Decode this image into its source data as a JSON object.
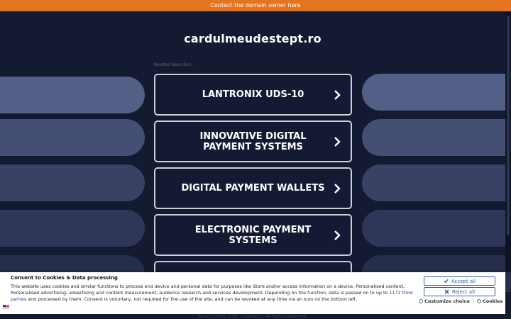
{
  "topbar": {
    "text": "Contact the domain owner here"
  },
  "page": {
    "domain": "cardulmeudestept.ro",
    "related_label": "Related Searches:"
  },
  "cards": [
    {
      "label": "LANTRONIX UDS-10"
    },
    {
      "label": "INNOVATIVE DIGITAL PAYMENT SYSTEMS"
    },
    {
      "label": "DIGITAL PAYMENT WALLETS"
    },
    {
      "label": "ELECTRONIC PAYMENT SYSTEMS"
    },
    {
      "label": ""
    }
  ],
  "footer": {
    "text": "Privacy Policy  2025 Copyright | All Rights Reserved."
  },
  "consent": {
    "title": "Consent to Cookies & Data processing",
    "text_before": "This website uses cookies and similar functions to process end device and personal data for purposes like Store and/or access information on a device, Personalised content, Personalised advertising, advertising and content measurement, audience research and services development. Depending on the function, data is passed on to up to ",
    "link": "1172 third parties",
    "text_after": " and processed by them. Consent is voluntary, not required for the use of the site, and can be revoked at any time via an icon on the bottom left.",
    "accept_label": "Accept all",
    "reject_label": "Reject all",
    "customize_label": "Customize choice",
    "separator": "|",
    "cookies_label": "Cookies"
  },
  "colors": {
    "topbar": "#e5741f",
    "background": "#141a33",
    "card_border": "#cfd0d6",
    "button_blue": "#2f5ea8"
  }
}
